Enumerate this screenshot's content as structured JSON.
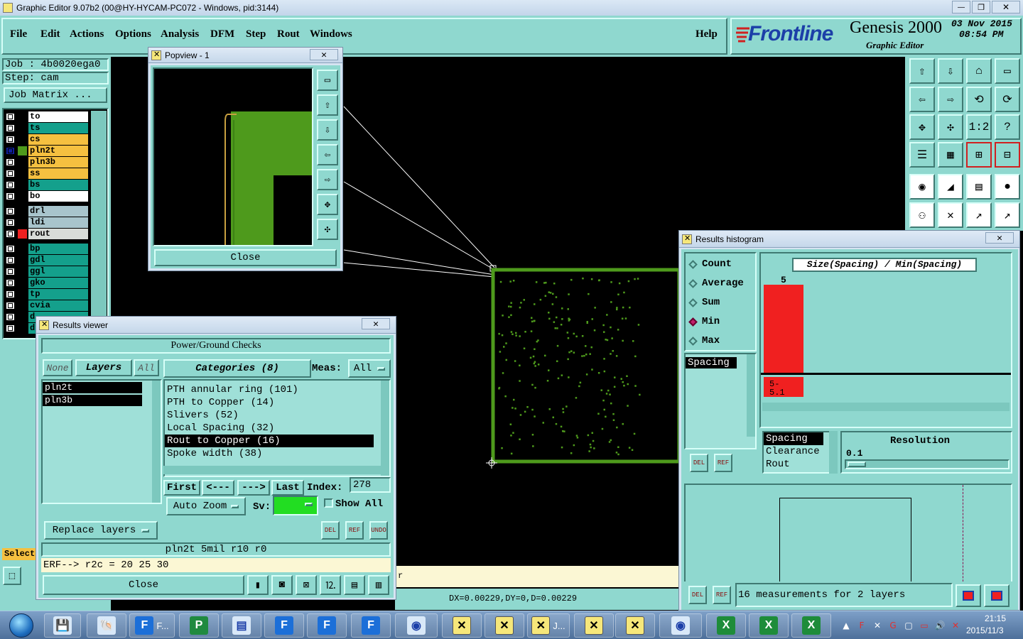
{
  "titlebar": {
    "title": "Graphic Editor 9.07b2 (00@HY-HYCAM-PC072 - Windows, pid:3144)",
    "minimize": "—",
    "maximize": "❐",
    "close": "✕"
  },
  "menu": {
    "items": [
      "File",
      "Edit",
      "Actions",
      "Options",
      "Analysis",
      "DFM",
      "Step",
      "Rout",
      "Windows"
    ],
    "help": "Help"
  },
  "brand": {
    "logo": "Frontline",
    "product": "Genesis 2000",
    "subtitle": "Graphic Editor",
    "date": "03 Nov 2015",
    "time": "08:54 PM"
  },
  "job": {
    "job_label": "Job : 4b0020ega0",
    "step_label": "Step: cam",
    "matrix_button": "Job Matrix ..."
  },
  "layers": [
    {
      "name": "to",
      "color": "#ffffff"
    },
    {
      "name": "ts",
      "color": "#14a08c"
    },
    {
      "name": "cs",
      "color": "#f5c040"
    },
    {
      "name": "pln2t",
      "color": "#f5c040"
    },
    {
      "name": "pln3b",
      "color": "#f5c040"
    },
    {
      "name": "ss",
      "color": "#f5c040"
    },
    {
      "name": "bs",
      "color": "#14a08c"
    },
    {
      "name": "bo",
      "color": "#ffffff"
    },
    {
      "name": "drl",
      "color": "#a8c4cc"
    },
    {
      "name": "ldi",
      "color": "#a8c4cc"
    },
    {
      "name": "rout",
      "color": "#d8dcd8"
    },
    {
      "name": "bp",
      "color": "#14a08c"
    },
    {
      "name": "gdl",
      "color": "#14a08c"
    },
    {
      "name": "ggl",
      "color": "#14a08c"
    },
    {
      "name": "gko",
      "color": "#14a08c"
    },
    {
      "name": "tp",
      "color": "#14a08c"
    },
    {
      "name": "cvia",
      "color": "#14a08c"
    },
    {
      "name": "d",
      "color": "#14a08c"
    },
    {
      "name": "d",
      "color": "#14a08c"
    }
  ],
  "left_bottom": {
    "select": "Select"
  },
  "popview": {
    "title": "Popview - 1",
    "close_button": "Close"
  },
  "results_viewer": {
    "title": "Results viewer",
    "header": "Power/Ground Checks",
    "none_btn": "None",
    "layers_btn": "Layers",
    "all_btn": "All",
    "layer_items": [
      "pln2t",
      "pln3b"
    ],
    "categories_btn": "Categories (8)",
    "meas_label": "Meas:",
    "meas_value": "All",
    "categories": [
      "PTH annular ring (101)",
      "PTH to Copper (14)",
      "Slivers (52)",
      "Local Spacing (32)",
      "Rout to Copper (16)",
      "Spoke width (38)"
    ],
    "first_btn": "First",
    "prev_btn": "<---",
    "next_btn": "--->",
    "last_btn": "Last",
    "index_label": "Index:",
    "index_value": "278",
    "auto_zoom": "Auto Zoom",
    "sv_label": "Sv:",
    "show_all": "Show All",
    "replace_layers": "Replace layers",
    "del": "DEL",
    "ref": "REF",
    "undo": "UNDO",
    "status": "pln2t 5mil  r10  r0",
    "erf": "ERF--> r2c = 20 25 30",
    "close_button": "Close"
  },
  "histogram": {
    "title": "Results histogram",
    "options": [
      "Count",
      "Average",
      "Sum",
      "Min",
      "Max"
    ],
    "selected_option": "Min",
    "title_box": "Size(Spacing) / Min(Spacing)",
    "category_list": [
      "Spacing"
    ],
    "bar_value_label": "5",
    "bin_label": "5-\n5.1",
    "bar_color": "#f02020",
    "bottom_list": [
      "Spacing",
      "Clearance",
      "Rout"
    ],
    "resolution_label": "Resolution",
    "resolution_value": "0.1",
    "del": "DEL",
    "ref": "REF",
    "measurements": "16 measurements for 2 layers"
  },
  "canvas": {
    "coords": "DX=0.00229,DY=0,D=0.00229",
    "fragment": "r",
    "board_color": "#4e9a1c"
  },
  "taskbar": {
    "clock_time": "21:15",
    "clock_date": "2015/11/3",
    "start": "start-orb",
    "task_f": "F...",
    "task_j": "J..."
  }
}
